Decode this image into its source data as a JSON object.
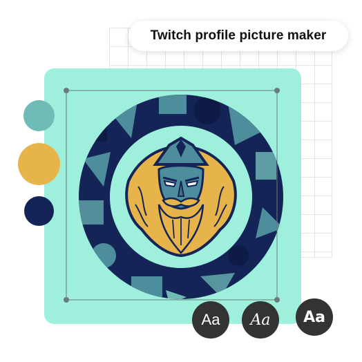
{
  "header": {
    "title": "Twitch profile picture maker"
  },
  "palette": {
    "swatches": [
      {
        "name": "teal",
        "color": "#6fbcb7"
      },
      {
        "name": "gold",
        "color": "#e7b34b"
      },
      {
        "name": "navy",
        "color": "#142457"
      }
    ],
    "canvas_background": "#9ef0dc"
  },
  "font_options": [
    {
      "label": "Aa",
      "style": "regular"
    },
    {
      "label": "Aa",
      "style": "script"
    },
    {
      "label": "Aa",
      "style": "bold"
    }
  ],
  "logo": {
    "subject": "bearded-warrior-mascot",
    "colors": {
      "gold": "#e7b34b",
      "navy": "#142457",
      "steel": "#4d8d9c"
    }
  }
}
